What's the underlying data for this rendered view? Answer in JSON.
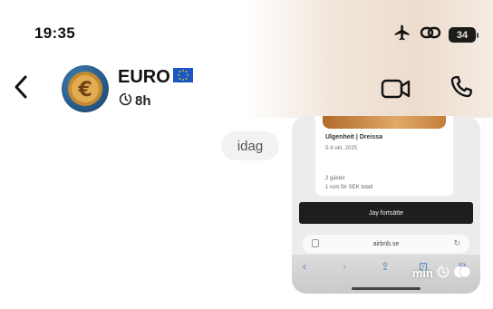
{
  "status_bar": {
    "time": "19:35",
    "battery": "34",
    "icons": [
      "airplane-icon",
      "link-icon",
      "battery-icon"
    ]
  },
  "header": {
    "back_icon": "chevron-left-icon",
    "contact_name": "EURO",
    "name_flag": "eu-flag-icon",
    "avatar_symbol": "€",
    "last_seen": "8h",
    "timer_icon": "timer-icon",
    "actions": [
      "video-call-icon",
      "phone-icon"
    ]
  },
  "chat": {
    "date_separator": "idag",
    "message": {
      "type": "image",
      "preview": {
        "card_title": "Ulgenheit | Dreissa",
        "card_date": "5-9 okt. 2025",
        "card_sub1": "2 gäster",
        "card_sub2": "1 rum för SEK totalt",
        "button_label": "Jay fortsätte",
        "url": "airbnb.se"
      },
      "time": "min",
      "status_icons": [
        "timer-icon",
        "read-receipt-icon"
      ]
    }
  },
  "colors": {
    "background": "#ffffff",
    "accent_blue": "#1a56c4",
    "date_chip": "#f2f2f2",
    "text": "#111111"
  }
}
